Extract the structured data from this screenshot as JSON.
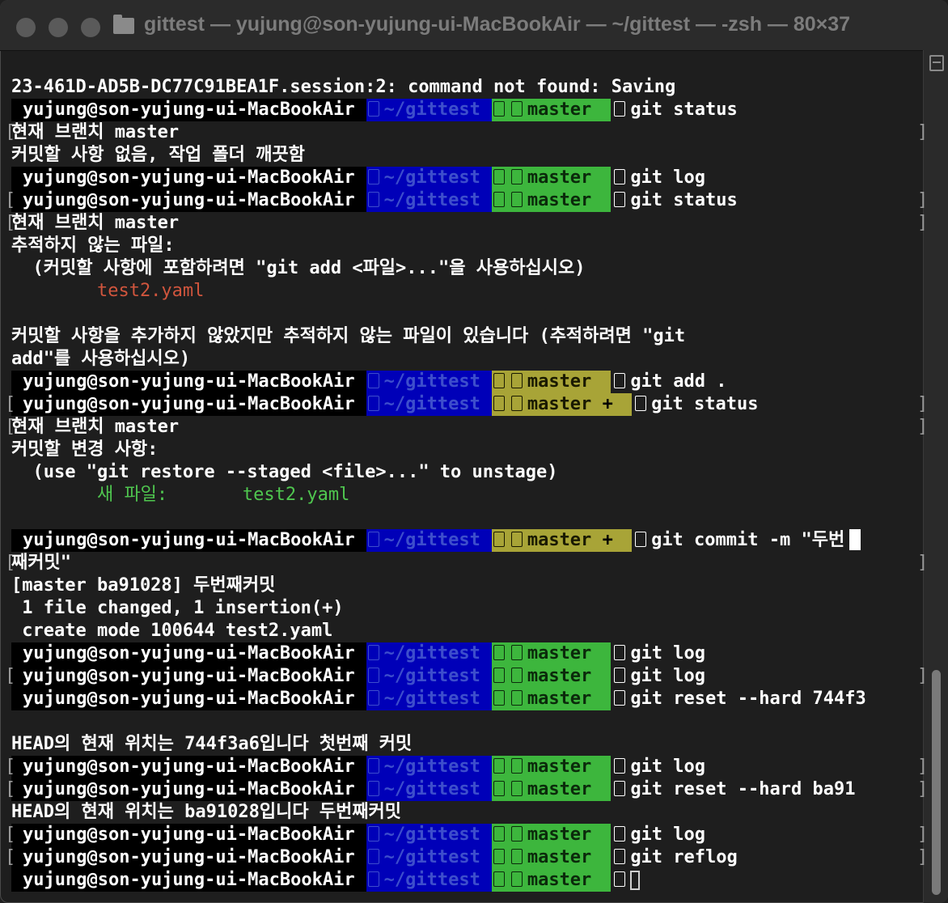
{
  "window": {
    "title": "gittest — yujung@son-yujung-ui-MacBookAir — ~/gittest — -zsh — 80×37"
  },
  "prompt": {
    "user": "yujung@son-yujung-ui-MacBookAir",
    "dir": "~/gittest",
    "branch": "master",
    "dirty_mark": "+"
  },
  "lines": {
    "l0": "23-461D-AD5B-DC77C91BEA1F.session:2: command not found: Saving",
    "c1": "git status",
    "o1a": "현재 브랜치 master",
    "o1b": "커밋할 사항 없음, 작업 폴더 깨끗함",
    "c2": "git log",
    "c3": "git status",
    "o3a": "현재 브랜치 master",
    "o3b": "추적하지 않는 파일:",
    "o3c": "  (커밋할 사항에 포함하려면 \"git add <파일>...\"을 사용하십시오)",
    "o3d": "        test2.yaml",
    "o3e": "커밋할 사항을 추가하지 않았지만 추적하지 않는 파일이 있습니다 (추적하려면 \"git",
    "o3f": "add\"를 사용하십시오)",
    "c4": "git add .",
    "c5": "git status",
    "o5a": "현재 브랜치 master",
    "o5b": "커밋할 변경 사항:",
    "o5c": "  (use \"git restore --staged <file>...\" to unstage)",
    "o5d_label": "        새 파일:",
    "o5d_file": "       test2.yaml",
    "c6": "git commit -m \"두번",
    "c6b": "째커밋\"",
    "o6a": "[master ba91028] 두번째커밋",
    "o6b": " 1 file changed, 1 insertion(+)",
    "o6c": " create mode 100644 test2.yaml",
    "c7": "git log",
    "c8": "git log",
    "c9": "git reset --hard 744f3",
    "o9": "HEAD의 현재 위치는 744f3a6입니다 첫번째 커밋",
    "c10": "git log",
    "c11": "git reset --hard ba91",
    "o11": "HEAD의 현재 위치는 ba91028입니다 두번째커밋",
    "c12": "git log",
    "c13": "git reflog"
  }
}
